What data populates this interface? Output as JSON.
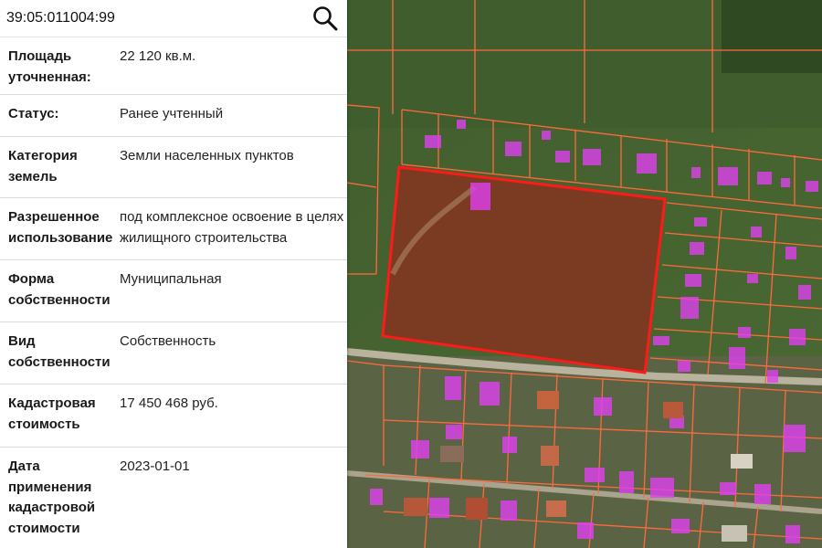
{
  "search": {
    "value": "39:05:011004:99",
    "button_icon": "search-icon"
  },
  "info_rows": [
    {
      "label": "Площадь уточненная:",
      "value": "22 120 кв.м."
    },
    {
      "label": "Статус:",
      "value": "Ранее учтенный"
    },
    {
      "label": "Категория земель",
      "value": "Земли населенных пунктов"
    },
    {
      "label": "Разрешенное использование",
      "value": "под комплексное освоение в целях жилищного строительства"
    },
    {
      "label": "Форма собственности",
      "value": "Муниципальная"
    },
    {
      "label": "Вид собственности",
      "value": "Собственность"
    },
    {
      "label": "Кадастровая стоимость",
      "value": "17 450 468 руб."
    },
    {
      "label": "Дата применения кадастровой стоимости",
      "value": "2023-01-01"
    }
  ],
  "map": {
    "layer": "satellite",
    "parcel_boundary_color": "#ff6a3d",
    "selected_parcel_color": "#ff1a1a",
    "building_color": "#e040f0"
  }
}
